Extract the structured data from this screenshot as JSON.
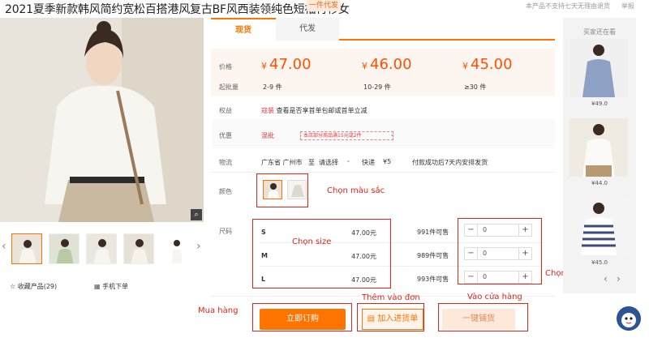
{
  "title": "2021夏季新款韩风简约宽松百搭港风复古BF风西装领纯色短袖衬衫女",
  "badge": "一件代发",
  "notice": "本产品不支持七天无理由退货",
  "report": "举报",
  "favorite": "☆  收藏产品(29)",
  "mobile_order": "手机下单",
  "tabs": [
    "现货",
    "代发"
  ],
  "price_label": "价格",
  "moq_label": "起批量",
  "currency": "¥",
  "prices": [
    {
      "price": "47.00",
      "qty": "2-9 件"
    },
    {
      "price": "46.00",
      "qty": "10-29 件"
    },
    {
      "price": "45.00",
      "qty": "≥30 件"
    }
  ],
  "benefit": {
    "label": "权益",
    "tag": "寇装",
    "text": "查看是否享首单包邮或首单立减"
  },
  "promo": {
    "label": "优惠",
    "type": "混批",
    "text": "本店部分商品满15元或2件"
  },
  "logistics": {
    "label": "物流",
    "from": "广东省 广州市",
    "arrow": "至",
    "select": "请选择",
    "express": "快递",
    "fee": "¥5",
    "ship_note": "付款成功后7天内安排发货"
  },
  "color_label": "颜色",
  "size_label": "尺码",
  "sizes": [
    {
      "name": "S",
      "price": "47.00元",
      "stock": "991件可售",
      "value": "0"
    },
    {
      "name": "M",
      "price": "47.00元",
      "stock": "989件可售",
      "value": "0"
    },
    {
      "name": "L",
      "price": "47.00元",
      "stock": "993件可售",
      "value": "0"
    }
  ],
  "buttons": {
    "buy": "立即订购",
    "cart": "加入进货单",
    "shop": "一键铺货"
  },
  "annotations": {
    "color": "Chọn màu sắc",
    "size": "Chọn size",
    "qty": "Chọn số lượng",
    "buy": "Mua hàng",
    "cart": "Thêm vào đơn",
    "shop": "Vào cửa hàng"
  },
  "sidebar": {
    "title": "买家还在看",
    "items": [
      {
        "price": "¥49.0"
      },
      {
        "price": "¥44.0"
      },
      {
        "price": "¥45.0"
      }
    ]
  },
  "colors": {
    "accent": "#ff7300",
    "price": "#ff5000",
    "annotation": "#e0231b"
  }
}
